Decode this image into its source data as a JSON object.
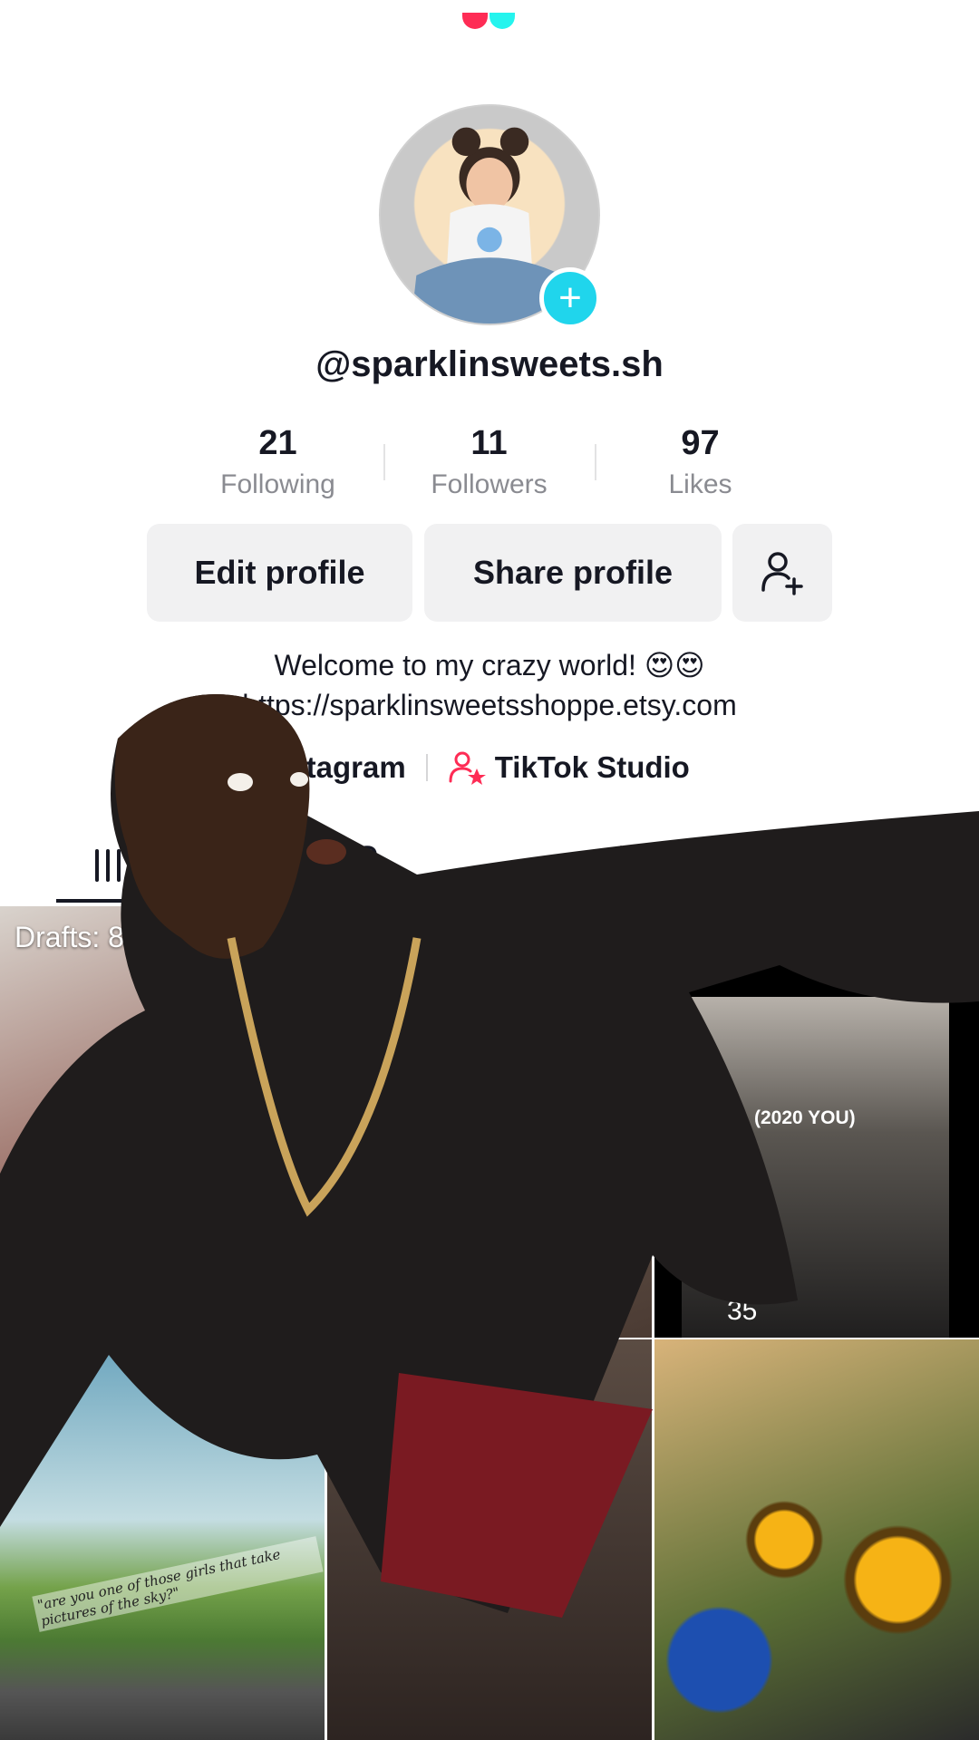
{
  "profile": {
    "username": "@sparklinsweets.sh",
    "bio": "Welcome to my crazy world! 😍😍",
    "link": "https://sparklinsweetsshoppe.etsy.com"
  },
  "stats": [
    {
      "value": "21",
      "label": "Following"
    },
    {
      "value": "11",
      "label": "Followers"
    },
    {
      "value": "97",
      "label": "Likes"
    }
  ],
  "buttons": {
    "edit": "Edit profile",
    "share": "Share profile",
    "add_friend_icon": "add-person-icon"
  },
  "links_row": {
    "instagram": "Instagram",
    "studio": "TikTok Studio"
  },
  "tabs": [
    {
      "icon": "grid-icon",
      "active": true
    },
    {
      "icon": "lock-icon",
      "active": false
    },
    {
      "icon": "repost-icon",
      "active": false
    },
    {
      "icon": "bookmark-icon",
      "active": false
    }
  ],
  "grid": {
    "drafts": "Drafts: 8",
    "tile3_caption": "(2020 YOU)",
    "tile3_views": "35",
    "tile4_caption": "\"are you one of those girls that take pictures of the sky?\""
  },
  "colors": {
    "accent_cyan": "#20d5ec",
    "brand_red": "#fe2c55",
    "button_bg": "#f1f1f2"
  }
}
